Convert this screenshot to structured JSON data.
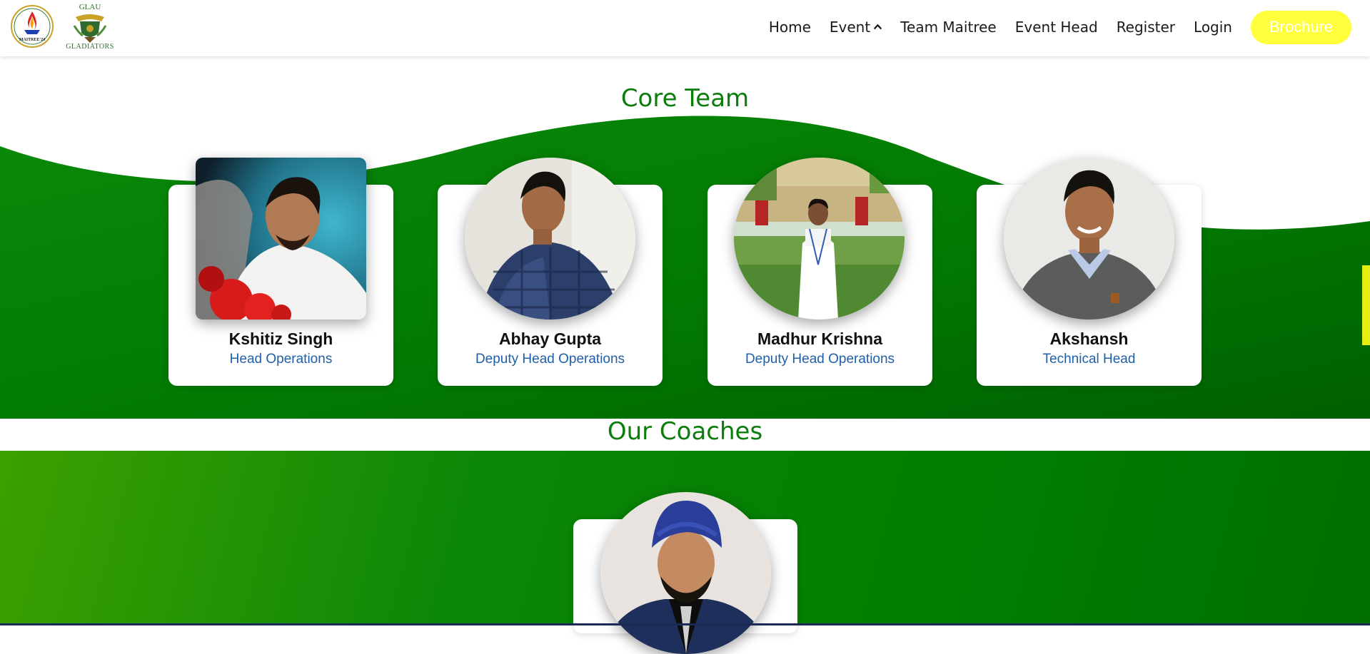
{
  "header": {
    "logos": {
      "maitree_text": "MAITREE'24",
      "glau_top": "GLAU",
      "glau_bottom": "GLADIATORS"
    },
    "nav": [
      {
        "label": "Home"
      },
      {
        "label": "Event",
        "icon": "chevron-up-icon"
      },
      {
        "label": "Team Maitree"
      },
      {
        "label": "Event Head"
      },
      {
        "label": "Register"
      },
      {
        "label": "Login"
      }
    ],
    "brochure_label": "Brochure"
  },
  "core_team": {
    "title": "Core Team",
    "members": [
      {
        "name": "Kshitiz Singh",
        "role": "Head Operations"
      },
      {
        "name": "Abhay Gupta",
        "role": "Deputy Head Operations"
      },
      {
        "name": "Madhur Krishna",
        "role": "Deputy Head Operations"
      },
      {
        "name": "Akshansh",
        "role": "Technical Head"
      }
    ]
  },
  "coaches": {
    "title": "Our Coaches"
  },
  "colors": {
    "brand_green": "#0a7d0a",
    "brochure_yellow": "#ffff3b",
    "role_blue": "#1f5fa8"
  }
}
